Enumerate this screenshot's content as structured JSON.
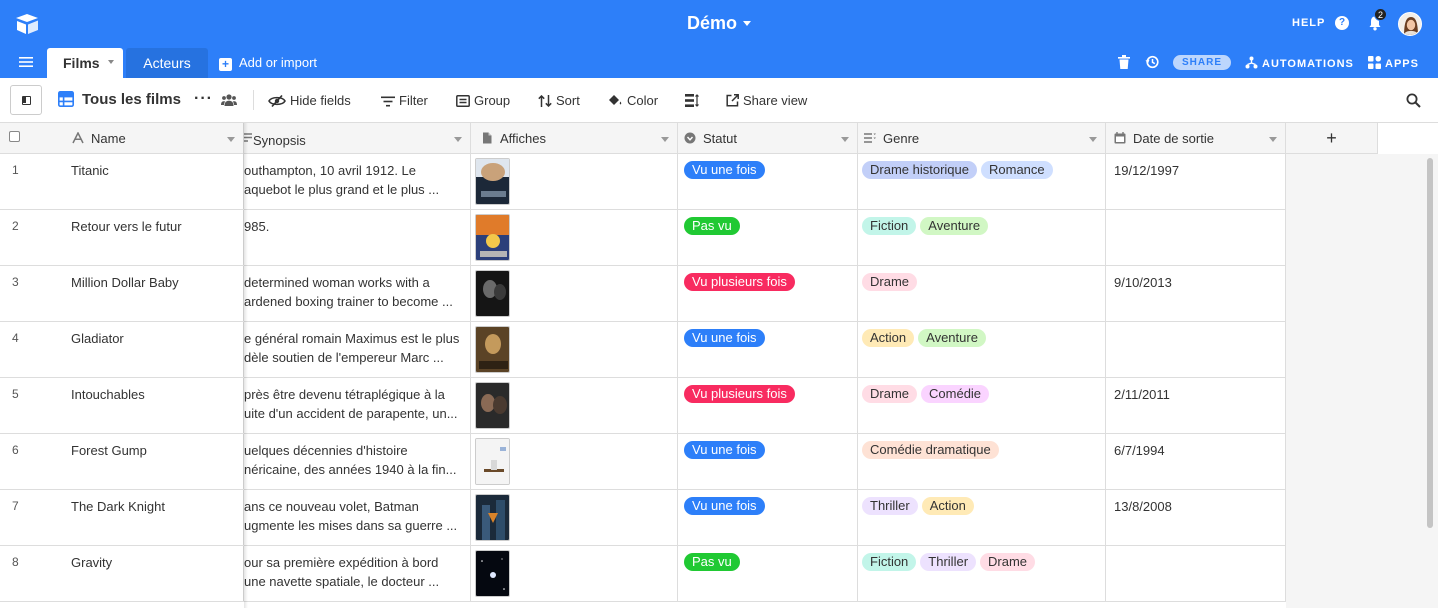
{
  "app": {
    "base_title": "Démo",
    "help_label": "HELP",
    "help_glyph": "?",
    "notif_count": "2",
    "brand_color": "#2d7ff9"
  },
  "tabs": [
    {
      "label": "Films",
      "active": true
    },
    {
      "label": "Acteurs",
      "active": false
    }
  ],
  "tabbar": {
    "add_import_label": "Add or import",
    "add_glyph": "+",
    "share_label": "SHARE",
    "automations_label": "AUTOMATIONS",
    "apps_label": "APPS"
  },
  "toolbar": {
    "view_name": "Tous les films",
    "more_glyph": "···",
    "hide_fields": "Hide fields",
    "filter": "Filter",
    "group": "Group",
    "sort": "Sort",
    "color": "Color",
    "share_view": "Share view"
  },
  "columns": {
    "name": "Name",
    "synopsis": "Synopsis",
    "affiches": "Affiches",
    "statut": "Statut",
    "genre": "Genre",
    "date": "Date de sortie",
    "add_glyph": "+"
  },
  "status_colors": {
    "Vu une fois": "#2d7ff9",
    "Pas vu": "#20c933",
    "Vu plusieurs fois": "#f82b60"
  },
  "genre_colors": {
    "Drame historique": "#c2cff8",
    "Romance": "#cfdfff",
    "Fiction": "#c2f5e9",
    "Aventure": "#d1f7c4",
    "Drame": "#ffdce5",
    "Action": "#ffeab6",
    "Comédie": "#fad4ff",
    "Comédie dramatique": "#fee2d5",
    "Thriller": "#ede2fe"
  },
  "rows": [
    {
      "num": "1",
      "name": "Titanic",
      "synopsis": [
        "outhampton, 10 avril 1912. Le",
        "aquebot le plus grand et le plus ..."
      ],
      "poster": "poster-titanic",
      "statut": "Vu une fois",
      "genres": [
        "Drame historique",
        "Romance"
      ],
      "date": "19/12/1997"
    },
    {
      "num": "2",
      "name": "Retour vers le futur",
      "synopsis": [
        "985.",
        ""
      ],
      "poster": "poster-back-to-the-future",
      "statut": "Pas vu",
      "genres": [
        "Fiction",
        "Aventure"
      ],
      "date": ""
    },
    {
      "num": "3",
      "name": "Million Dollar Baby",
      "synopsis": [
        "determined woman works with a",
        "ardened boxing trainer to become ..."
      ],
      "poster": "poster-million-dollar-baby",
      "statut": "Vu plusieurs fois",
      "genres": [
        "Drame"
      ],
      "date": "9/10/2013"
    },
    {
      "num": "4",
      "name": "Gladiator",
      "synopsis": [
        "e général romain Maximus est le plus",
        "dèle soutien de l'empereur Marc ..."
      ],
      "poster": "poster-gladiator",
      "statut": "Vu une fois",
      "genres": [
        "Action",
        "Aventure"
      ],
      "date": ""
    },
    {
      "num": "5",
      "name": "Intouchables",
      "synopsis": [
        "près être devenu tétraplégique à la",
        "uite d'un accident de parapente, un..."
      ],
      "poster": "poster-intouchables",
      "statut": "Vu plusieurs fois",
      "genres": [
        "Drame",
        "Comédie"
      ],
      "date": "2/11/2011"
    },
    {
      "num": "6",
      "name": "Forest Gump",
      "synopsis": [
        "uelques décennies d'histoire",
        "néricaine, des années 1940 à la fin..."
      ],
      "poster": "poster-forrest-gump",
      "statut": "Vu une fois",
      "genres": [
        "Comédie dramatique"
      ],
      "date": "6/7/1994"
    },
    {
      "num": "7",
      "name": "The Dark Knight",
      "synopsis": [
        "ans ce nouveau volet, Batman",
        "ugmente les mises dans sa guerre ..."
      ],
      "poster": "poster-dark-knight",
      "statut": "Vu une fois",
      "genres": [
        "Thriller",
        "Action"
      ],
      "date": "13/8/2008"
    },
    {
      "num": "8",
      "name": "Gravity",
      "synopsis": [
        "our sa première expédition à bord",
        "une navette spatiale, le docteur ..."
      ],
      "poster": "poster-gravity",
      "statut": "Pas vu",
      "genres": [
        "Fiction",
        "Thriller",
        "Drame"
      ],
      "date": ""
    }
  ]
}
